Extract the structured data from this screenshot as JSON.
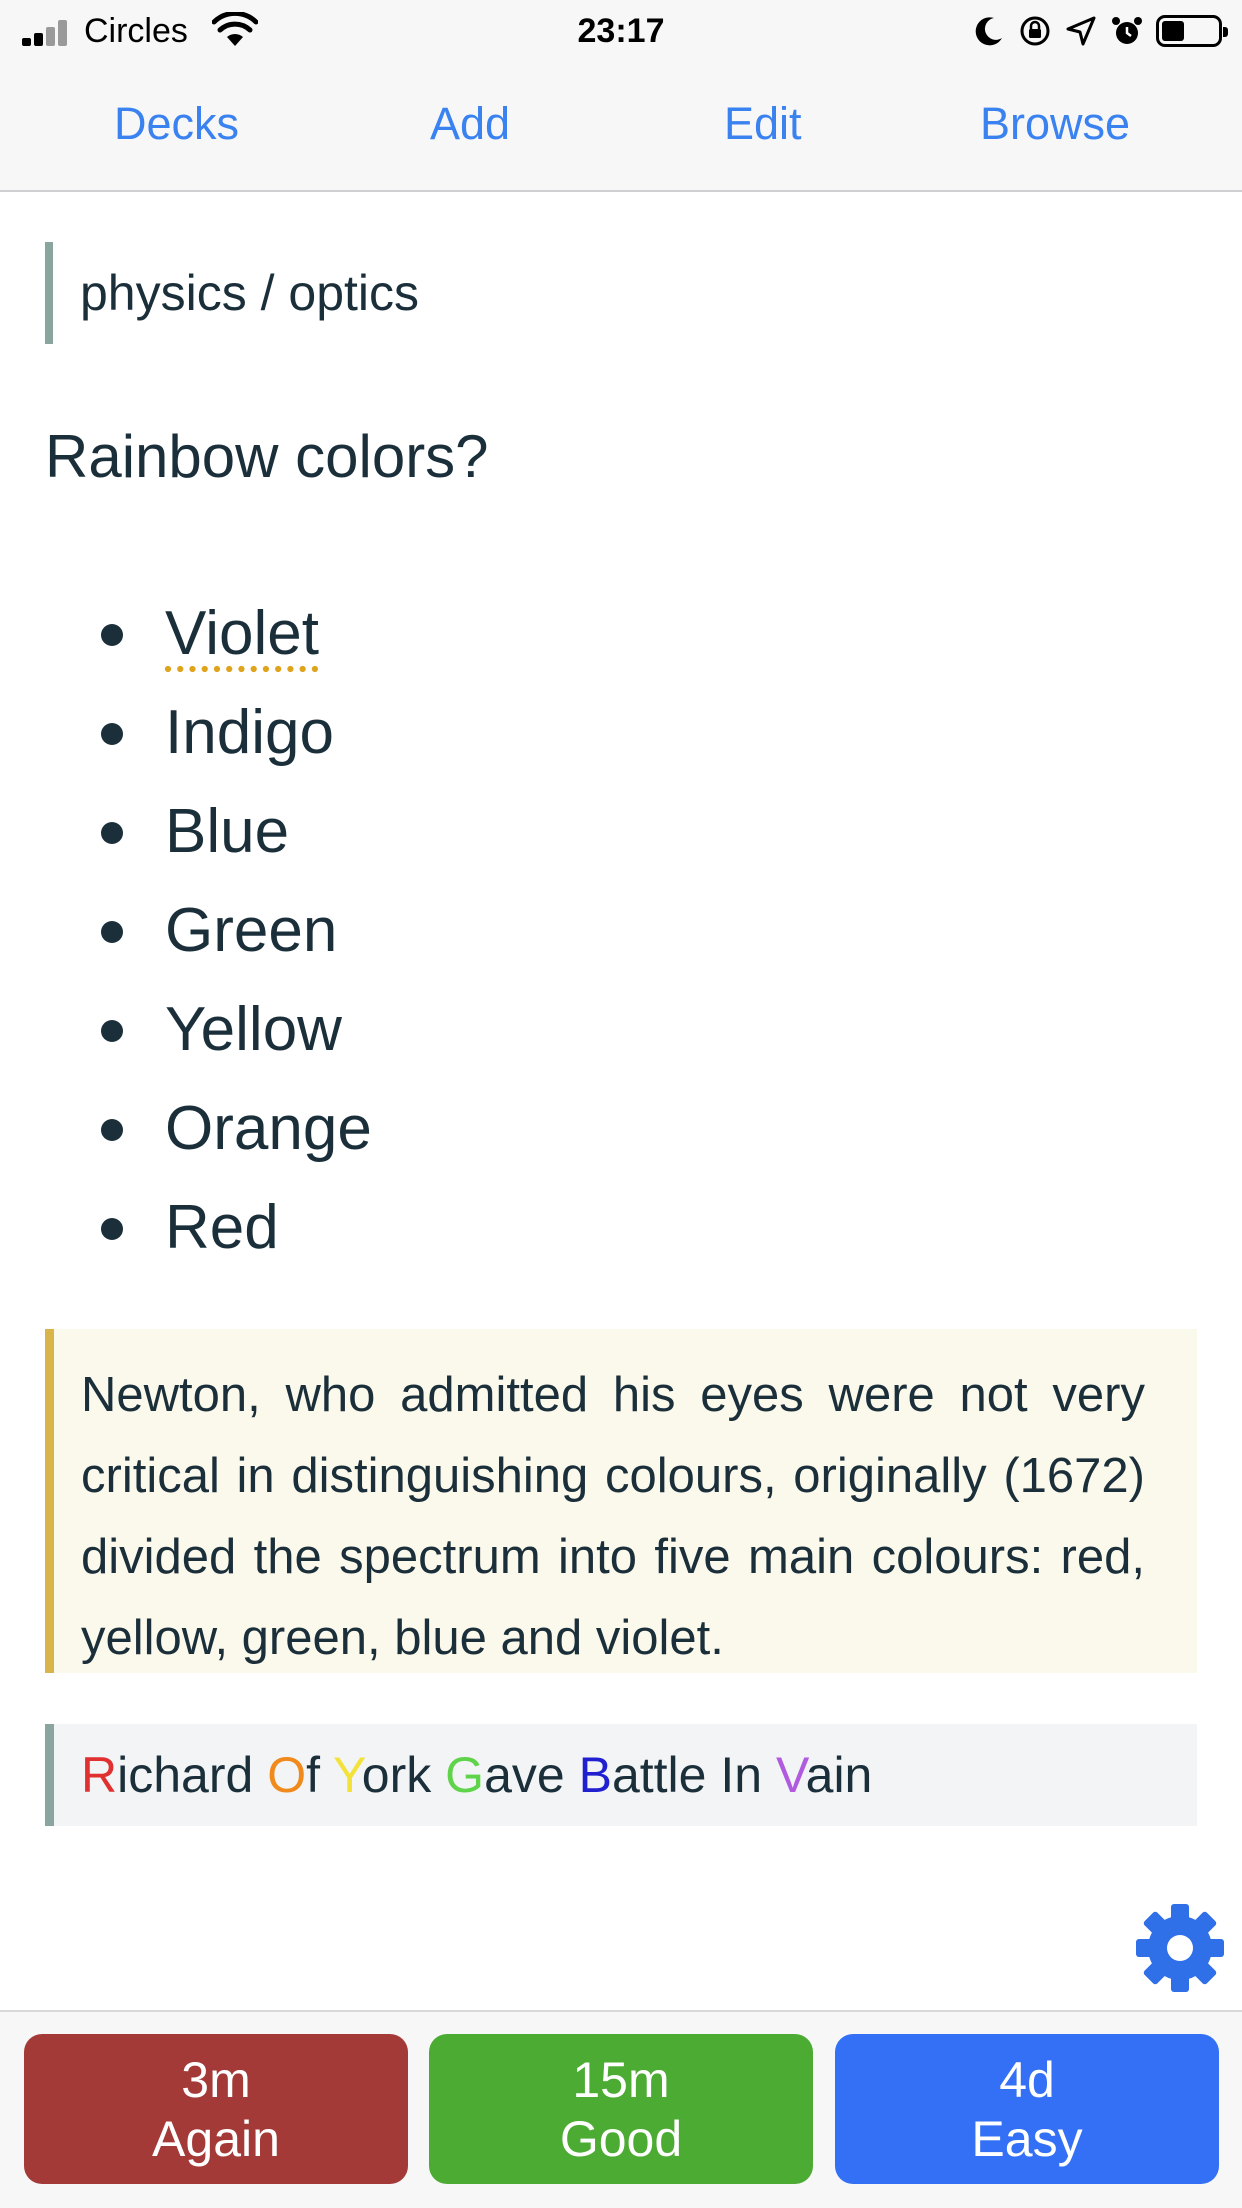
{
  "status_bar": {
    "carrier": "Circles",
    "time": "23:17",
    "icons": [
      "signal-icon",
      "wifi-icon",
      "moon-icon",
      "rotation-lock-icon",
      "location-arrow-icon",
      "alarm-icon",
      "battery-icon"
    ]
  },
  "nav": {
    "decks": "Decks",
    "add": "Add",
    "edit": "Edit",
    "browse": "Browse",
    "accent_color": "#3a82f0"
  },
  "card": {
    "tags": "physics / optics",
    "question": "Rainbow colors?",
    "answers": [
      "Violet",
      "Indigo",
      "Blue",
      "Green",
      "Yellow",
      "Orange",
      "Red"
    ],
    "note": "Newton, who admitted his eyes were not very critical in distinguishing colours, originally (1672) divided the spectrum into five main colours: red, yellow, green, blue and violet.",
    "mnemonic": [
      {
        "first": "R",
        "rest": "ichard",
        "color": "#e03030"
      },
      {
        "first": "O",
        "rest": "f",
        "color": "#f08a1c"
      },
      {
        "first": "Y",
        "rest": "ork",
        "color": "#f2e23a"
      },
      {
        "first": "G",
        "rest": "ave",
        "color": "#5fd34a"
      },
      {
        "first": "B",
        "rest": "attle",
        "color": "#2020d0"
      },
      {
        "first": "I",
        "rest": "n",
        "color": "#1b2f3a"
      },
      {
        "first": "V",
        "rest": "ain",
        "color": "#b05ae0"
      }
    ]
  },
  "settings_icon": "gear-icon",
  "answer_buttons": {
    "again": {
      "interval": "3m",
      "label": "Again",
      "color": "#a33a38"
    },
    "good": {
      "interval": "15m",
      "label": "Good",
      "color": "#4cab32"
    },
    "easy": {
      "interval": "4d",
      "label": "Easy",
      "color": "#3370f5"
    }
  }
}
